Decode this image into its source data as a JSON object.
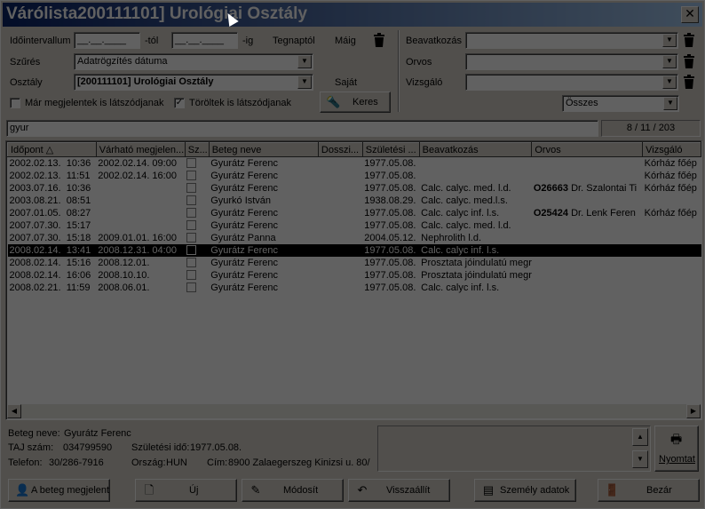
{
  "window": {
    "title": "Várólista200111101] Urológiai Osztály",
    "close_glyph": "✕"
  },
  "filters": {
    "time_label": "Időintervallum",
    "from_value": "__.__.____",
    "from_suffix": "-tól",
    "to_value": "__.__.____",
    "to_suffix": "-ig",
    "yesterday": "Tegnaptól",
    "today": "Máig",
    "filter_label": "Szűrés",
    "filter_value": "Adatrögzítés dátuma",
    "dept_label": "Osztály",
    "dept_value": "[200111101] Urológiai Osztály",
    "own_label": "Saját",
    "chk_appeared": "Már megjelentek is látszódjanak",
    "chk_deleted": "Töröltek is látszódjanak",
    "search_button": "Keres",
    "procedure_label": "Beavatkozás",
    "doctor_label": "Orvos",
    "examiner_label": "Vizsgáló",
    "status_value": "Összes"
  },
  "search": {
    "value": "gyur",
    "counter": "8 / 11 / 203"
  },
  "grid": {
    "columns": [
      "Időpont",
      "Várható megjelen...",
      "Sz...",
      "Beteg neve",
      "Dosszi...",
      "Születési ...",
      "Beavatkozás",
      "Orvos",
      "Vizsgáló"
    ],
    "rows": [
      {
        "date": "2002.02.13.",
        "time": "10:36",
        "expected": "2002.02.14.  09:00",
        "name": "Gyurátz Ferenc",
        "dossier": "",
        "birth": "1977.05.08.",
        "procedure": "",
        "doc_code": "",
        "doctor": "",
        "examiner": "Kórház főép",
        "selected": false
      },
      {
        "date": "2002.02.13.",
        "time": "11:51",
        "expected": "2002.02.14.  16:00",
        "name": "Gyurátz Ferenc",
        "dossier": "",
        "birth": "1977.05.08.",
        "procedure": "",
        "doc_code": "",
        "doctor": "",
        "examiner": "Kórház főép",
        "selected": false
      },
      {
        "date": "2003.07.16.",
        "time": "10:36",
        "expected": "",
        "name": "Gyurátz Ferenc",
        "dossier": "",
        "birth": "1977.05.08.",
        "procedure": "Calc. calyc. med. l.d.",
        "doc_code": "O26663",
        "doctor": "Dr. Szalontai Ti",
        "examiner": "Kórház főép",
        "selected": false
      },
      {
        "date": "2003.08.21.",
        "time": "08:51",
        "expected": "",
        "name": "Gyurkó István",
        "dossier": "",
        "birth": "1938.08.29.",
        "procedure": "Calc. calyc. med.l.s.",
        "doc_code": "",
        "doctor": "",
        "examiner": "",
        "selected": false
      },
      {
        "date": "2007.01.05.",
        "time": "08:27",
        "expected": "",
        "name": "Gyurátz Ferenc",
        "dossier": "",
        "birth": "1977.05.08.",
        "procedure": "Calc. calyc inf. l.s.",
        "doc_code": "O25424",
        "doctor": "Dr. Lenk Feren",
        "examiner": "Kórház főép",
        "selected": false
      },
      {
        "date": "2007.07.30.",
        "time": "15:17",
        "expected": "",
        "name": "Gyurátz Ferenc",
        "dossier": "",
        "birth": "1977.05.08.",
        "procedure": "Calc. calyc. med. l.d.",
        "doc_code": "",
        "doctor": "",
        "examiner": "",
        "selected": false
      },
      {
        "date": "2007.07.30.",
        "time": "15:18",
        "expected": "2009.01.01.  16:00",
        "name": "Gyurátz Panna",
        "dossier": "",
        "birth": "2004.05.12.",
        "procedure": "Nephrolith l.d.",
        "doc_code": "",
        "doctor": "",
        "examiner": "",
        "selected": false
      },
      {
        "date": "2008.02.14.",
        "time": "13:41",
        "expected": "2008.12.31.  04:00",
        "name": "Gyurátz Ferenc",
        "dossier": "",
        "birth": "1977.05.08.",
        "procedure": "Calc. calyc inf. l.s.",
        "doc_code": "",
        "doctor": "",
        "examiner": "",
        "selected": true
      },
      {
        "date": "2008.02.14.",
        "time": "15:16",
        "expected": "2008.12.01.",
        "name": "Gyurátz Ferenc",
        "dossier": "",
        "birth": "1977.05.08.",
        "procedure": "Prosztata jóindulatú megr",
        "doc_code": "",
        "doctor": "",
        "examiner": "",
        "selected": false
      },
      {
        "date": "2008.02.14.",
        "time": "16:06",
        "expected": "2008.10.10.",
        "name": "Gyurátz Ferenc",
        "dossier": "",
        "birth": "1977.05.08.",
        "procedure": "Prosztata jóindulatú megr",
        "doc_code": "",
        "doctor": "",
        "examiner": "",
        "selected": false
      },
      {
        "date": "2008.02.21.",
        "time": "11:59",
        "expected": "2008.06.01.",
        "name": "Gyurátz Ferenc",
        "dossier": "",
        "birth": "1977.05.08.",
        "procedure": "Calc. calyc inf. l.s.",
        "doc_code": "",
        "doctor": "",
        "examiner": "",
        "selected": false
      }
    ]
  },
  "details": {
    "patient_label": "Beteg neve:",
    "patient_value": "Gyurátz Ferenc",
    "taj_label": "TAJ szám:",
    "taj_value": "034799590",
    "birth_label": "Születési idő:",
    "birth_value": "1977.05.08.",
    "phone_label": "Telefon:",
    "phone_value": "30/286-7916",
    "country_label": "Ország:",
    "country_value": "HUN",
    "address_label": "Cím:",
    "address_value": "8900 Zalaegerszeg Kinizsi u. 80/"
  },
  "buttons": {
    "print": "Nyomtat",
    "appeared": "A beteg megjelent",
    "new": "Új",
    "modify": "Módosít",
    "restore": "Visszaállít",
    "person": "Személy adatok",
    "close": "Bezár"
  }
}
